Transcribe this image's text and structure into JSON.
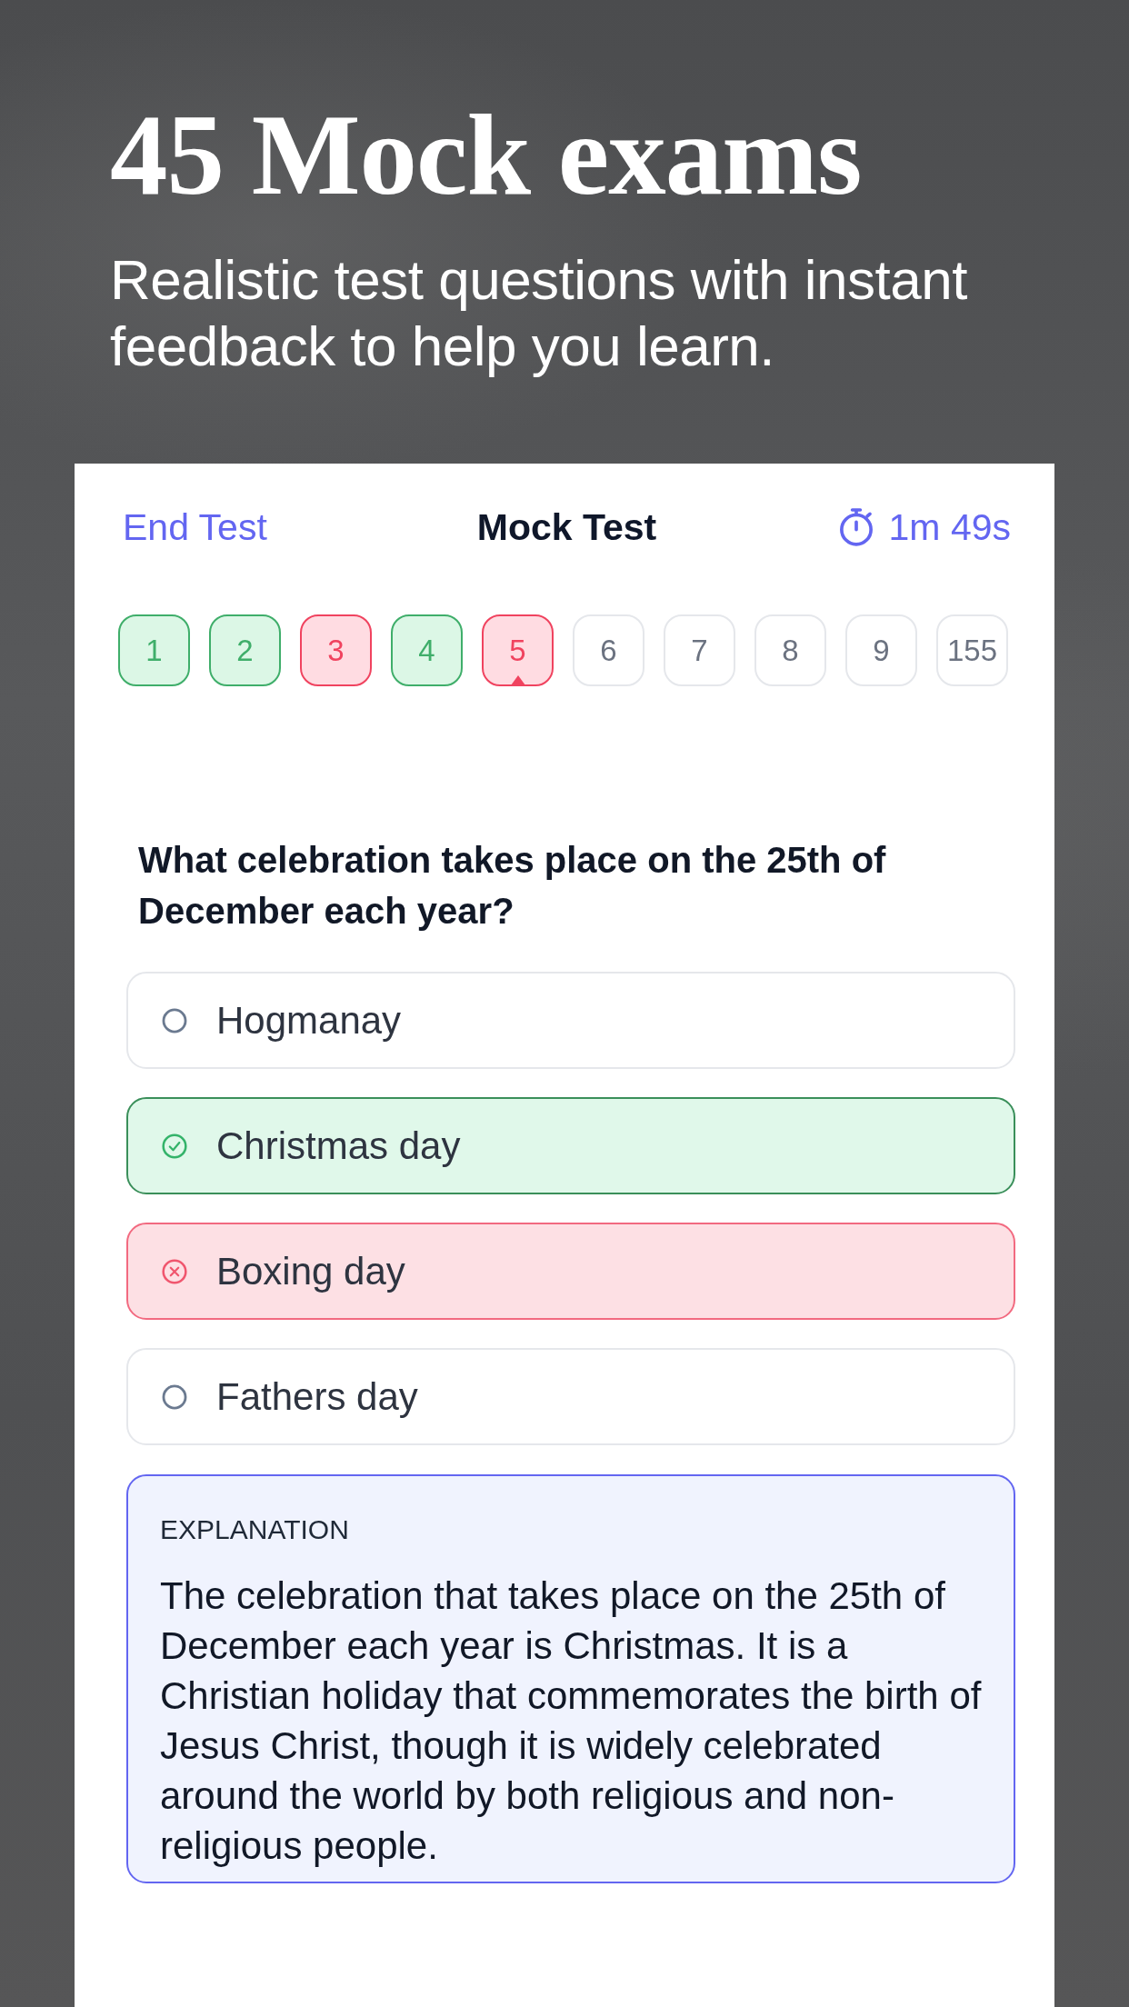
{
  "promo": {
    "title": "45 Mock exams",
    "subtitle": "Realistic test questions with instant feedback to help you learn."
  },
  "header": {
    "end_button": "End Test",
    "title": "Mock Test",
    "timer": "1m 49s"
  },
  "questions": [
    {
      "label": "1",
      "kind": "correct",
      "selected": false
    },
    {
      "label": "2",
      "kind": "correct",
      "selected": false
    },
    {
      "label": "3",
      "kind": "incorrect",
      "selected": false
    },
    {
      "label": "4",
      "kind": "correct",
      "selected": false
    },
    {
      "label": "5",
      "kind": "incorrect",
      "selected": true
    },
    {
      "label": "6",
      "kind": "unanswered",
      "selected": false
    },
    {
      "label": "7",
      "kind": "unanswered",
      "selected": false
    },
    {
      "label": "8",
      "kind": "unanswered",
      "selected": false
    },
    {
      "label": "9",
      "kind": "unanswered",
      "selected": false
    },
    {
      "label": "155",
      "kind": "unanswered",
      "selected": false
    }
  ],
  "question": {
    "text": "What celebration takes place on the 25th of December each year?",
    "options": [
      {
        "label": "Hogmanay",
        "selected": false,
        "correct": false
      },
      {
        "label": "Christmas day",
        "selected": false,
        "correct": true
      },
      {
        "label": "Boxing day",
        "selected": true,
        "correct": false
      },
      {
        "label": "Fathers day",
        "selected": false,
        "correct": false
      }
    ]
  },
  "explanation": {
    "heading": "EXPLANATION",
    "text": "The celebration that takes place on the 25th of December each year is Christmas. It is a Christian holiday that commemorates the birth of Jesus Christ, though it is widely celebrated around the world by both religious and non-religious people."
  }
}
